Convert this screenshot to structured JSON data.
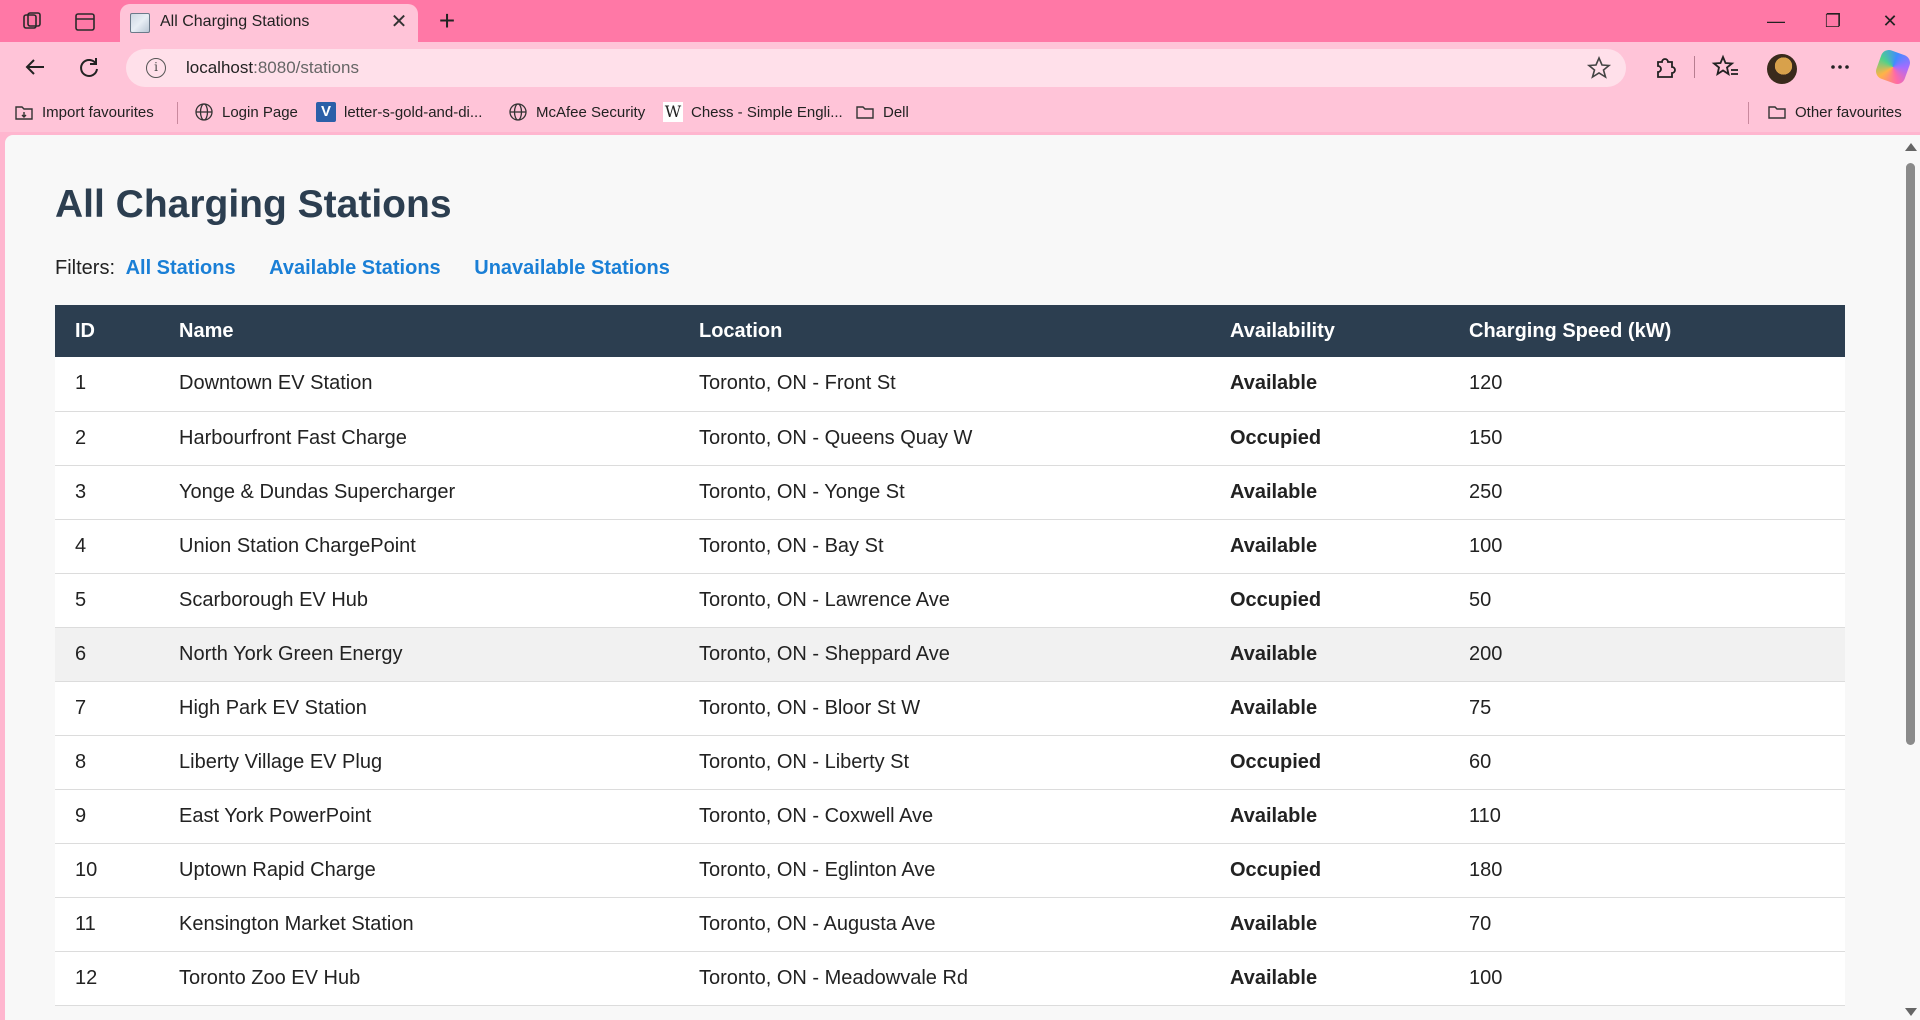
{
  "browser": {
    "tab": {
      "title": "All Charging Stations",
      "close_glyph": "✕"
    },
    "new_tab_glyph": "+",
    "window_controls": {
      "minimize": "—",
      "restore": "❐",
      "close": "✕"
    },
    "address": {
      "host": "localhost",
      "path": ":8080/stations",
      "info_glyph": "i"
    },
    "bookmarks": [
      {
        "label": "Import favourites",
        "icon": "import-icon"
      },
      {
        "label": "Login Page",
        "icon": "globe-icon"
      },
      {
        "label": "letter-s-gold-and-di...",
        "icon": "v-logo-icon"
      },
      {
        "label": "McAfee Security",
        "icon": "globe-icon"
      },
      {
        "label": "Chess - Simple Engli...",
        "icon": "wikipedia-icon"
      },
      {
        "label": "Dell",
        "icon": "folder-icon"
      }
    ],
    "other_favourites": "Other favourites"
  },
  "page": {
    "title": "All Charging Stations",
    "filters": {
      "label": "Filters:",
      "all": "All Stations",
      "available": "Available Stations",
      "unavailable": "Unavailable Stations"
    },
    "table": {
      "headers": [
        "ID",
        "Name",
        "Location",
        "Availability",
        "Charging Speed (kW)"
      ],
      "rows": [
        {
          "id": "1",
          "name": "Downtown EV Station",
          "location": "Toronto, ON - Front St",
          "availability": "Available",
          "speed": "120"
        },
        {
          "id": "2",
          "name": "Harbourfront Fast Charge",
          "location": "Toronto, ON - Queens Quay W",
          "availability": "Occupied",
          "speed": "150"
        },
        {
          "id": "3",
          "name": "Yonge & Dundas Supercharger",
          "location": "Toronto, ON - Yonge St",
          "availability": "Available",
          "speed": "250"
        },
        {
          "id": "4",
          "name": "Union Station ChargePoint",
          "location": "Toronto, ON - Bay St",
          "availability": "Available",
          "speed": "100"
        },
        {
          "id": "5",
          "name": "Scarborough EV Hub",
          "location": "Toronto, ON - Lawrence Ave",
          "availability": "Occupied",
          "speed": "50"
        },
        {
          "id": "6",
          "name": "North York Green Energy",
          "location": "Toronto, ON - Sheppard Ave",
          "availability": "Available",
          "speed": "200"
        },
        {
          "id": "7",
          "name": "High Park EV Station",
          "location": "Toronto, ON - Bloor St W",
          "availability": "Available",
          "speed": "75"
        },
        {
          "id": "8",
          "name": "Liberty Village EV Plug",
          "location": "Toronto, ON - Liberty St",
          "availability": "Occupied",
          "speed": "60"
        },
        {
          "id": "9",
          "name": "East York PowerPoint",
          "location": "Toronto, ON - Coxwell Ave",
          "availability": "Available",
          "speed": "110"
        },
        {
          "id": "10",
          "name": "Uptown Rapid Charge",
          "location": "Toronto, ON - Eglinton Ave",
          "availability": "Occupied",
          "speed": "180"
        },
        {
          "id": "11",
          "name": "Kensington Market Station",
          "location": "Toronto, ON - Augusta Ave",
          "availability": "Available",
          "speed": "70"
        },
        {
          "id": "12",
          "name": "Toronto Zoo EV Hub",
          "location": "Toronto, ON - Meadowvale Rd",
          "availability": "Available",
          "speed": "100"
        }
      ]
    }
  },
  "colors": {
    "titlebar": "#ff78a6",
    "toolbar": "#ffc4d8",
    "header_bg": "#2c3e50",
    "link": "#1a7fd6",
    "available": "#108010",
    "occupied": "#e01010"
  }
}
